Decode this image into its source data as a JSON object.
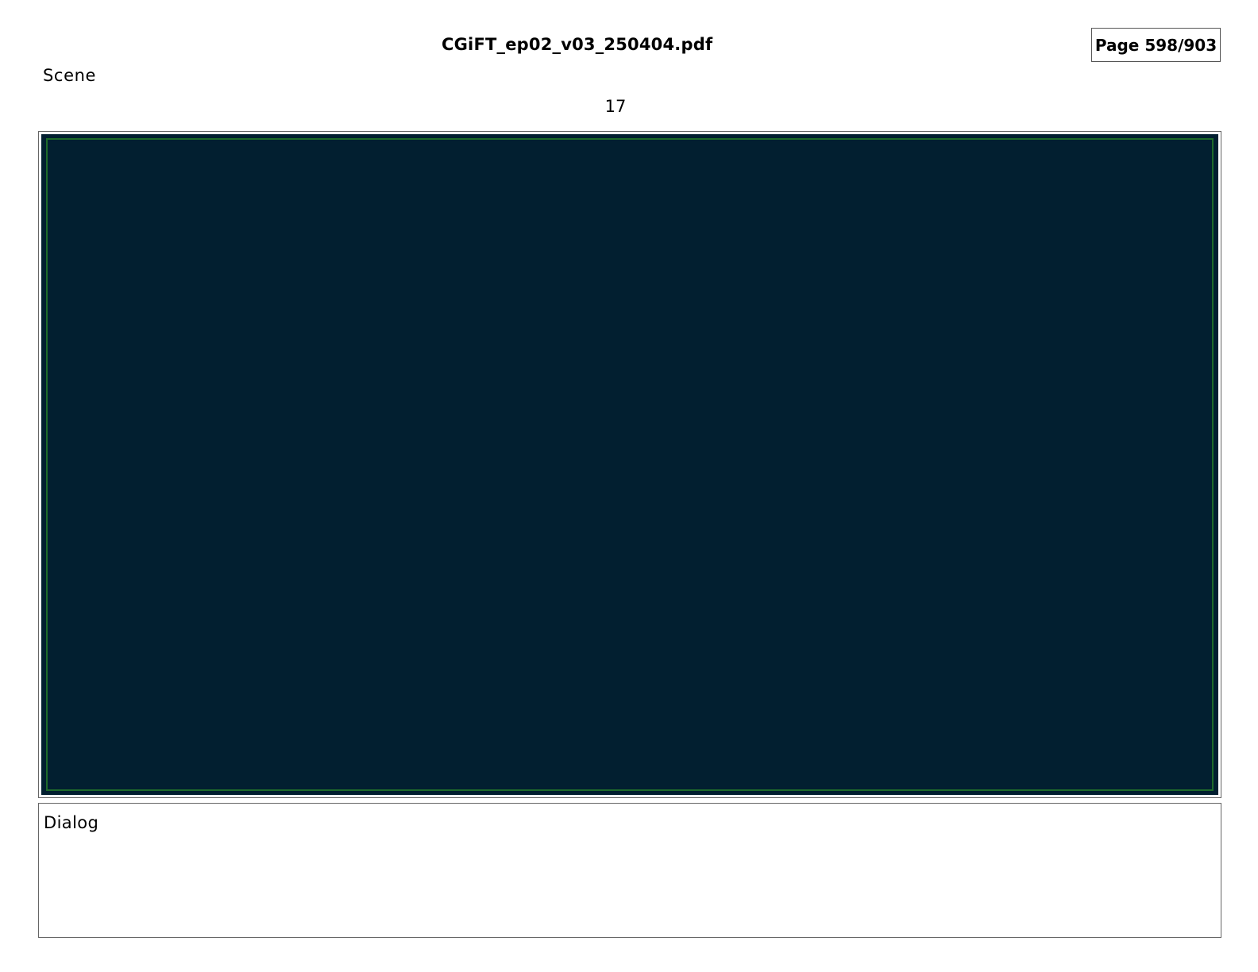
{
  "header": {
    "document_title": "CGiFT_ep02_v03_250404.pdf",
    "page_indicator": "Page 598/903"
  },
  "scene": {
    "label": "Scene",
    "number": "17"
  },
  "panel": {
    "background_color": "#021f30",
    "guide_color": "#1e6a2a"
  },
  "dialog": {
    "label": "Dialog",
    "text": ""
  }
}
